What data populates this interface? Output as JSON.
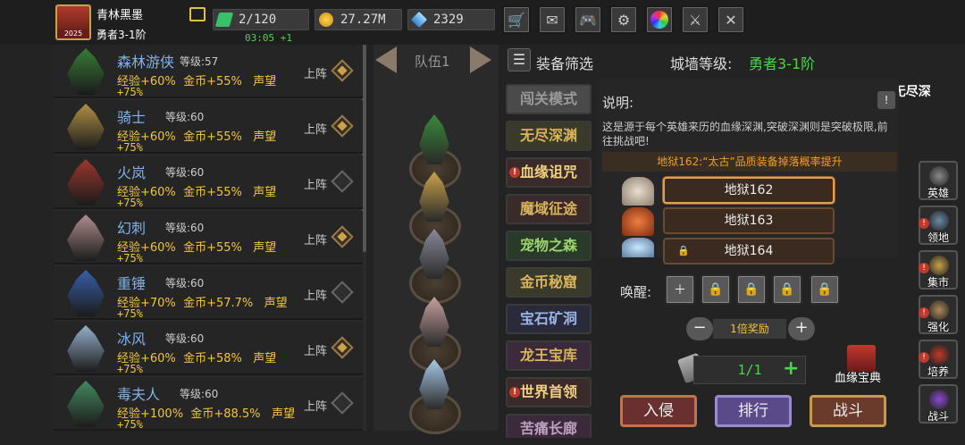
{
  "player": {
    "name": "青林黑墨",
    "rank": "勇者3-1阶",
    "avatar_level": "2025"
  },
  "resources": {
    "energy": "2/120",
    "energy_timer": "03:05",
    "energy_regen": "+1",
    "gold": "27.27M",
    "gems": "2329"
  },
  "top_buttons": [
    "shop-cart-icon",
    "mail-icon",
    "gamepad-icon",
    "gear-icon",
    "color-wheel-icon",
    "sword-icon",
    "crossed-swords-icon"
  ],
  "heroes": [
    {
      "name": "森林游侠",
      "level": "等级:57",
      "exp": "经验+60%",
      "gold": "金币+55%",
      "rep": "声望",
      "bonus": "+75%",
      "up": "上阵",
      "active": true
    },
    {
      "name": "骑士",
      "level": "等级:60",
      "exp": "经验+60%",
      "gold": "金币+55%",
      "rep": "声望",
      "bonus": "+75%",
      "up": "上阵",
      "active": true
    },
    {
      "name": "火岚",
      "level": "等级:60",
      "exp": "经验+60%",
      "gold": "金币+55%",
      "rep": "声望",
      "bonus": "+75%",
      "up": "上阵",
      "active": false
    },
    {
      "name": "幻刺",
      "level": "等级:60",
      "exp": "经验+60%",
      "gold": "金币+55%",
      "rep": "声望",
      "bonus": "+75%",
      "up": "上阵",
      "active": true
    },
    {
      "name": "重锤",
      "level": "等级:60",
      "exp": "经验+70%",
      "gold": "金币+57.7%",
      "rep": "声望",
      "bonus": "+75%",
      "up": "上阵",
      "active": false
    },
    {
      "name": "冰风",
      "level": "等级:60",
      "exp": "经验+60%",
      "gold": "金币+58%",
      "rep": "声望",
      "bonus": "+75%",
      "up": "上阵",
      "active": true
    },
    {
      "name": "毒夫人",
      "level": "等级:60",
      "exp": "经验+100%",
      "gold": "金币+88.5%",
      "rep": "声望",
      "bonus": "+75%",
      "up": "上阵",
      "active": false
    }
  ],
  "team": {
    "label": "队伍1"
  },
  "panel": {
    "filter_label": "装备筛选",
    "wall_label": "城墙等级:",
    "wall_value": "勇者3-1阶",
    "marquee": "运气爆棚!玩家蔽佬,在无尽深",
    "desc_title": "说明:",
    "desc_text": "这是源于每个英雄来历的血缘深渊,突破深渊则是突破极限,前往挑战吧!",
    "drop_text": "地狱162:“太古”品质装备掉落概率提升",
    "awaken_label": "唤醒:",
    "reward_text": "1倍奖励",
    "ticket_count": "1/1",
    "book_label": "血缘宝典"
  },
  "modes": [
    "闯关模式",
    "无尽深渊",
    "血缘诅咒",
    "魔域征途",
    "宠物之森",
    "金币秘窟",
    "宝石矿洞",
    "龙王宝库",
    "世界首领",
    "苦痛长廊"
  ],
  "floors": [
    "地狱162",
    "地狱163",
    "地狱164"
  ],
  "actions": {
    "invade": "入侵",
    "rank": "排行",
    "battle": "战斗"
  },
  "side_nav": [
    "英雄",
    "领地",
    "集市",
    "强化",
    "培养",
    "战斗"
  ],
  "colors": {
    "gold": "#f0c43c",
    "hero_name": "#7fb2e8",
    "wall_value": "#4cd44c"
  }
}
